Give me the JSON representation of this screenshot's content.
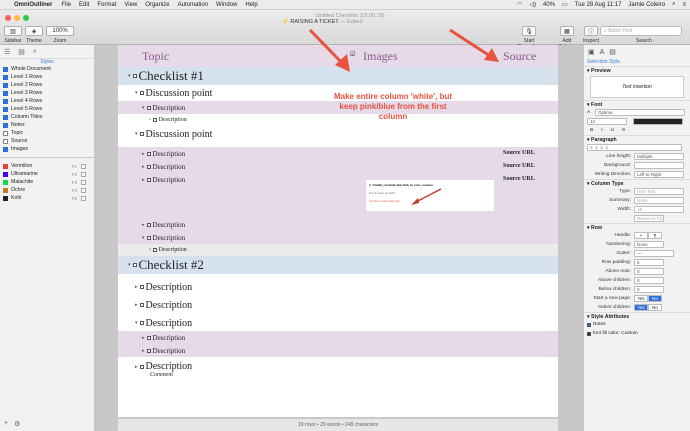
{
  "menubar": {
    "app": "OmniOutliner",
    "items": [
      "File",
      "Edit",
      "Format",
      "View",
      "Organize",
      "Automation",
      "Window",
      "Help"
    ],
    "battery": "40%",
    "clock": "Tue 28 Aug 11:17",
    "user": "Jamie Coleiro"
  },
  "window": {
    "title": "Untitled Checklist (19.08.18)",
    "doc_title": "RAISING A TICKET",
    "edited": "— Edited"
  },
  "toolbar": {
    "sidebar": "Sidebar",
    "theme": "Theme",
    "zoom": "Zoom",
    "zoom_value": "100%",
    "start_recording": "Start Recording",
    "add_column": "Add Column",
    "inspect": "Inspect",
    "search_placeholder": "Batch Find",
    "search_label": "Search"
  },
  "sidebar": {
    "title": "Styles",
    "items": [
      "Whole Document",
      "Level 1 Rows",
      "Level 2 Rows",
      "Level 3 Rows",
      "Level 4 Rows",
      "Level 5 Rows",
      "Column Titles",
      "Notes",
      "Topic",
      "Source",
      "Images"
    ],
    "named": [
      {
        "name": "Vermilion",
        "key": "F1",
        "color": "#e34234"
      },
      {
        "name": "Ultramarine",
        "key": "F2",
        "color": "#3f00ff"
      },
      {
        "name": "Malachite",
        "key": "F3",
        "color": "#0bda51"
      },
      {
        "name": "Ochre",
        "key": "F4",
        "color": "#cc7722"
      },
      {
        "name": "Kohl",
        "key": "F5",
        "color": "#222222"
      }
    ]
  },
  "columns": {
    "topic": "Topic",
    "images": "Images",
    "source": "Source"
  },
  "outline": {
    "h1": "Checklist #1",
    "dp1": "Discussion point",
    "d1": "Description",
    "d2": "Description",
    "dp2": "Discussion point",
    "d3": "Description",
    "d4": "Description",
    "d5": "Description",
    "d6": "Description",
    "d7": "Description",
    "d8": "Description",
    "h2": "Checklist #2",
    "d9": "Description",
    "d10": "Description",
    "d11": "Description",
    "d12": "Description",
    "d13": "Description",
    "d14": "Description",
    "comment": "Comment",
    "src1": "Source URL",
    "src2": "Source URL",
    "src3": "Source URL"
  },
  "image_embed": {
    "line1": "5. Finally, include that link in your content.",
    "line2": "It's as easy as that!",
    "line3": "Click to tweet this tip!"
  },
  "annotation": "Make entire column 'white', but keep pink/blue from the first column",
  "status": "19 rows • 29 words • 248 characters",
  "inspector": {
    "tab": "Selection Style",
    "preview": "Preview",
    "preview_text": "Text insertion",
    "font": "Font",
    "font_name": "Optima",
    "font_size": "12",
    "paragraph": "Paragraph",
    "line_height": "Line height:",
    "line_height_val": "Multiple",
    "background": "Background:",
    "writing_dir": "Writing Direction:",
    "writing_dir_val": "Left to Right",
    "column_type": "Column Type",
    "type": "Type:",
    "type_val": "Rich Text",
    "summary": "Summary:",
    "summary_val": "None",
    "width": "Width:",
    "width_val": "18",
    "resize": "Resize to Fit",
    "row": "Row",
    "handle": "Handle:",
    "numbering": "Numbering:",
    "numbering_val": "None",
    "gutter": "Gutter:",
    "row_padding": "Row padding:",
    "row_padding_val": "6",
    "above_note": "Above note:",
    "above_note_val": "0",
    "above_children": "Above children:",
    "above_children_val": "0",
    "below_children": "Below children:",
    "below_children_val": "0",
    "new_page": "Start a new page:",
    "indent_children": "Indent children:",
    "yes": "Yes",
    "no": "No",
    "style_attrs": "Style Attributes",
    "notes": "Notes",
    "font_fill": "font fill color: Custom"
  }
}
